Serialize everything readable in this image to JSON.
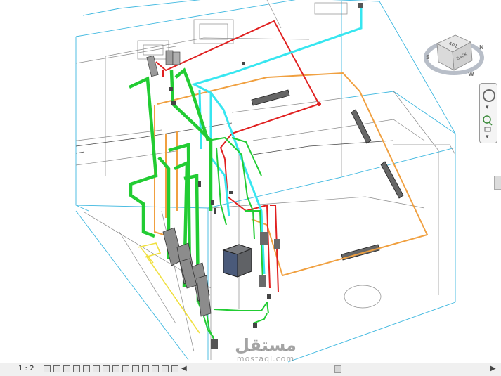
{
  "viewcube": {
    "face_top": "401",
    "face_front": "BACK",
    "icon": "viewcube-3d-icon"
  },
  "navbar": {
    "items": [
      "steering-wheel-icon",
      "zoom-icon"
    ]
  },
  "statusbar": {
    "scale": "1 : 2",
    "tools": [
      "detail-level-icon",
      "visual-style-icon",
      "sun-path-icon",
      "shadows-icon",
      "crop-view-icon",
      "show-crop-icon",
      "temporary-hide-icon",
      "reveal-hidden-icon",
      "lock-view-icon",
      "analysis-display-icon",
      "highlight-displacement-icon",
      "worksharing-icon",
      "design-options-icon",
      "temporary-view-properties-icon"
    ]
  },
  "watermark": {
    "arabic": "مستقل",
    "latin": "mostaql.com"
  },
  "colors": {
    "building_edges": "#3fb8e0",
    "pipe_green": "#22cc33",
    "pipe_red": "#e02020",
    "pipe_cyan": "#37e6f0",
    "pipe_orange": "#f0a040",
    "pipe_yellow": "#f0e040"
  }
}
